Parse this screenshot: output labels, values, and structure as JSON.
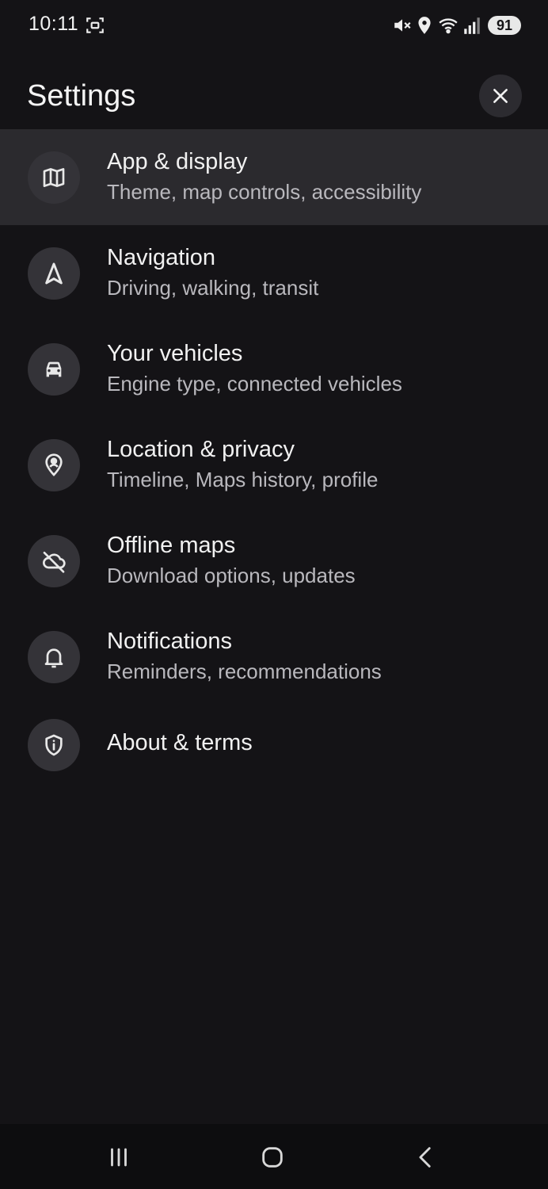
{
  "status_bar": {
    "time": "10:11",
    "battery": "91",
    "icons": [
      "screenshot-icon",
      "mute-icon",
      "location-icon",
      "wifi-icon",
      "signal-icon"
    ]
  },
  "header": {
    "title": "Settings",
    "close_icon": "close-icon"
  },
  "items": [
    {
      "title": "App & display",
      "subtitle": "Theme, map controls, accessibility",
      "icon": "map-icon",
      "selected": true
    },
    {
      "title": "Navigation",
      "subtitle": "Driving, walking, transit",
      "icon": "navigation-arrow-icon"
    },
    {
      "title": "Your vehicles",
      "subtitle": "Engine type, connected vehicles",
      "icon": "car-icon"
    },
    {
      "title": "Location & privacy",
      "subtitle": "Timeline, Maps history, profile",
      "icon": "person-pin-icon"
    },
    {
      "title": "Offline maps",
      "subtitle": "Download options, updates",
      "icon": "cloud-off-icon"
    },
    {
      "title": "Notifications",
      "subtitle": "Reminders, recommendations",
      "icon": "bell-icon"
    },
    {
      "title": "About & terms",
      "icon": "shield-info-icon"
    }
  ],
  "colors": {
    "background": "#141316",
    "selected_row": "#2b2a2e",
    "icon_circle": "#343338",
    "subtitle": "#b9b8bd"
  }
}
